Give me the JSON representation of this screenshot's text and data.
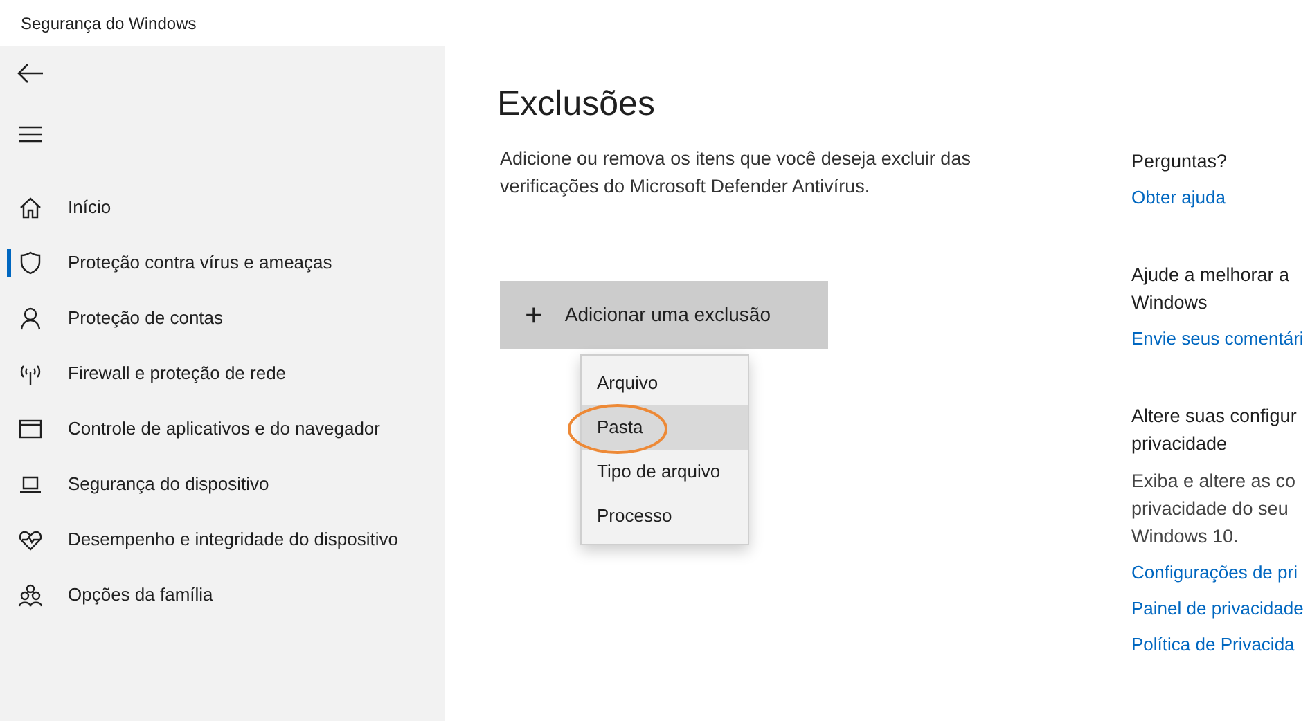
{
  "window": {
    "title": "Segurança do Windows"
  },
  "sidebar": {
    "items": [
      {
        "label": "Início",
        "kind": "home",
        "selected": false
      },
      {
        "label": "Proteção contra vírus e ameaças",
        "kind": "shield",
        "selected": true
      },
      {
        "label": "Proteção de contas",
        "kind": "person",
        "selected": false
      },
      {
        "label": "Firewall e proteção de rede",
        "kind": "antenna",
        "selected": false
      },
      {
        "label": "Controle de aplicativos e do navegador",
        "kind": "window",
        "selected": false
      },
      {
        "label": "Segurança do dispositivo",
        "kind": "laptop",
        "selected": false
      },
      {
        "label": "Desempenho e integridade do dispositivo",
        "kind": "heart",
        "selected": false
      },
      {
        "label": "Opções da família",
        "kind": "family",
        "selected": false
      }
    ]
  },
  "main": {
    "title": "Exclusões",
    "description": "Adicione ou remova os itens que você deseja excluir das verificações do Microsoft Defender Antivírus.",
    "add_button": {
      "icon": "+",
      "label": "Adicionar uma exclusão"
    },
    "menu": {
      "items": [
        {
          "label": "Arquivo",
          "selected": false,
          "circled": false
        },
        {
          "label": "Pasta",
          "selected": true,
          "circled": true
        },
        {
          "label": "Tipo de arquivo",
          "selected": false,
          "circled": false
        },
        {
          "label": "Processo",
          "selected": false,
          "circled": false
        }
      ]
    }
  },
  "aside": {
    "sections": [
      {
        "heading": [
          "Perguntas?"
        ],
        "links": [
          "Obter ajuda"
        ]
      },
      {
        "heading": [
          "Ajude a melhorar a",
          "Windows"
        ],
        "links": [
          "Envie seus comentári"
        ]
      },
      {
        "heading": [
          "Altere suas configur",
          "privacidade"
        ],
        "text": [
          "Exiba e altere as co",
          "privacidade do seu",
          "Windows 10."
        ],
        "links": [
          "Configurações de pri",
          "Painel de privacidade",
          "Política de Privacida"
        ]
      }
    ]
  }
}
